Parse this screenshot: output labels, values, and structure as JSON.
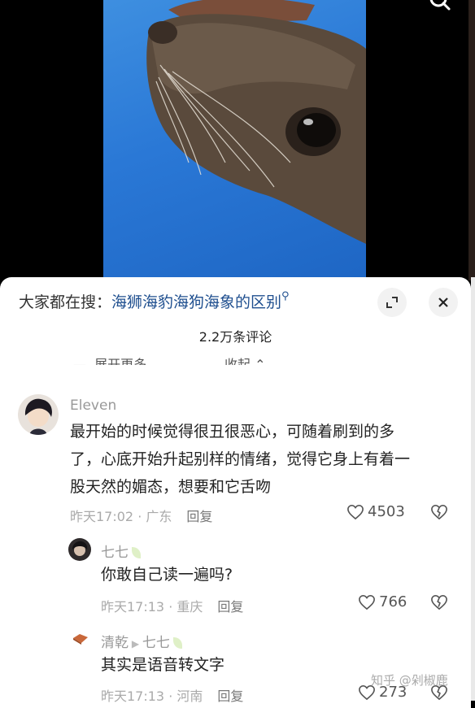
{
  "search_bar": {
    "prefix": "大家都在搜：",
    "keyword": "海狮海豹海狗海象的区别",
    "search_glyph": "⚲"
  },
  "comments_header": {
    "count": "2.2万条评论",
    "expand_label": "展开更多",
    "collapse_label": "收起"
  },
  "comments": [
    {
      "user": "Eleven",
      "text_lines": [
        "最开始的时候觉得很丑很恶心，可随着刷到的多",
        "了，心底开始升起别样的情绪，觉得它身上有着一",
        "股天然的媚态，想要和它舌吻"
      ],
      "time": "昨天17:02",
      "location": "广东",
      "reply_label": "回复",
      "likes": "4503"
    }
  ],
  "replies": [
    {
      "user": "七七",
      "text": "你敢自己读一遍吗?",
      "time": "昨天17:13",
      "location": "重庆",
      "reply_label": "回复",
      "likes": "766"
    },
    {
      "user": "清乾",
      "reply_to": "七七",
      "text": "其实是语音转文字",
      "time": "昨天17:13",
      "location": "河南",
      "reply_label": "回复",
      "likes": "273"
    }
  ],
  "watermark": "知乎 @剁椒鹿",
  "colors": {
    "keyword": "#1f4f8f",
    "meta": "#aaaaaa",
    "video_bg": "#2a78d6"
  }
}
